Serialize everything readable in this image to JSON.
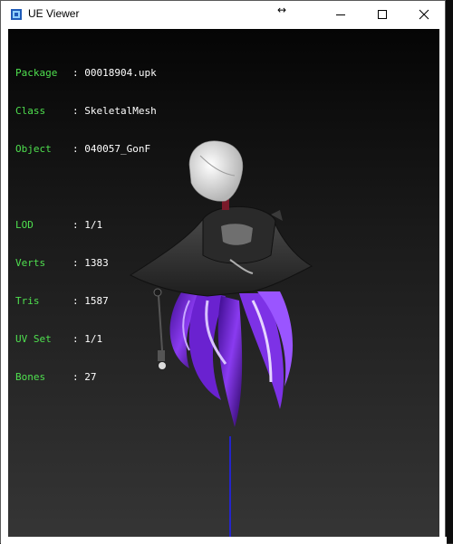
{
  "window": {
    "title": "UE Viewer"
  },
  "icons": {
    "app": "ue-viewer-icon",
    "minimize": "minimize-icon",
    "maximize": "maximize-icon",
    "close": "close-icon",
    "cursor": "resize-horizontal-cursor-icon"
  },
  "info": {
    "package": {
      "key": "Package",
      "value": "00018904.upk"
    },
    "class": {
      "key": "Class",
      "value": "SkeletalMesh"
    },
    "object": {
      "key": "Object",
      "value": "040057_GonF"
    },
    "lod": {
      "key": "LOD",
      "value": "1/1"
    },
    "verts": {
      "key": "Verts",
      "value": "1383"
    },
    "tris": {
      "key": "Tris",
      "value": "1587"
    },
    "uvset": {
      "key": "UV Set",
      "value": "1/1"
    },
    "bones": {
      "key": "Bones",
      "value": "27"
    }
  },
  "colors": {
    "label_green": "#4fe04f",
    "value_white": "#ffffff",
    "hair_purple": "#7b2fd6",
    "axis_blue": "#2020ff"
  }
}
